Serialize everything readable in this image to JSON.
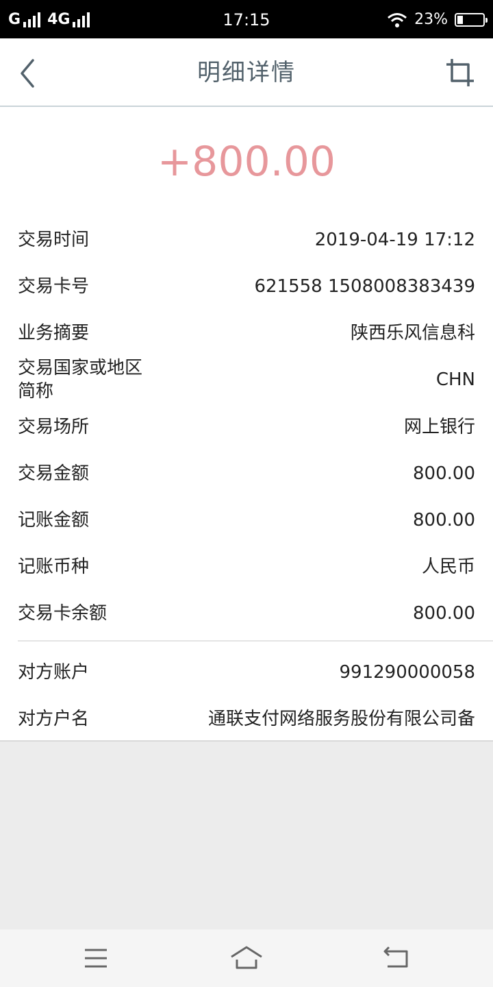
{
  "status_bar": {
    "carrier1": "G",
    "carrier2": "4G",
    "time": "17:15",
    "battery": "23%",
    "battery_level": 0.23
  },
  "nav": {
    "title": "明细详情",
    "back_icon": "chevron-left-icon",
    "crop_icon": "crop-icon"
  },
  "amount": "+800.00",
  "details": [
    {
      "label": "交易时间",
      "value": "2019-04-19 17:12"
    },
    {
      "label": "交易卡号",
      "value": "621558 1508008383439"
    },
    {
      "label": "业务摘要",
      "value": "陕西乐风信息科"
    },
    {
      "label_line1": "交易国家或地区",
      "label_line2": "简称",
      "value": "CHN"
    },
    {
      "label": "交易场所",
      "value": "网上银行"
    },
    {
      "label": "交易金额",
      "value": "800.00"
    },
    {
      "label": "记账金额",
      "value": "800.00"
    },
    {
      "label": "记账币种",
      "value": "人民币"
    },
    {
      "label": "交易卡余额",
      "value": "800.00"
    }
  ],
  "counterparty": [
    {
      "label": "对方账户",
      "value": "991290000058"
    },
    {
      "label": "对方户名",
      "value": "通联支付网络服务股份有限公司备"
    }
  ],
  "bottom_nav": {
    "menu_icon": "menu-icon",
    "home_icon": "home-icon",
    "back_icon": "return-icon"
  },
  "colors": {
    "amount": "#e7979b",
    "title": "#52616b",
    "icon": "#52616b"
  }
}
